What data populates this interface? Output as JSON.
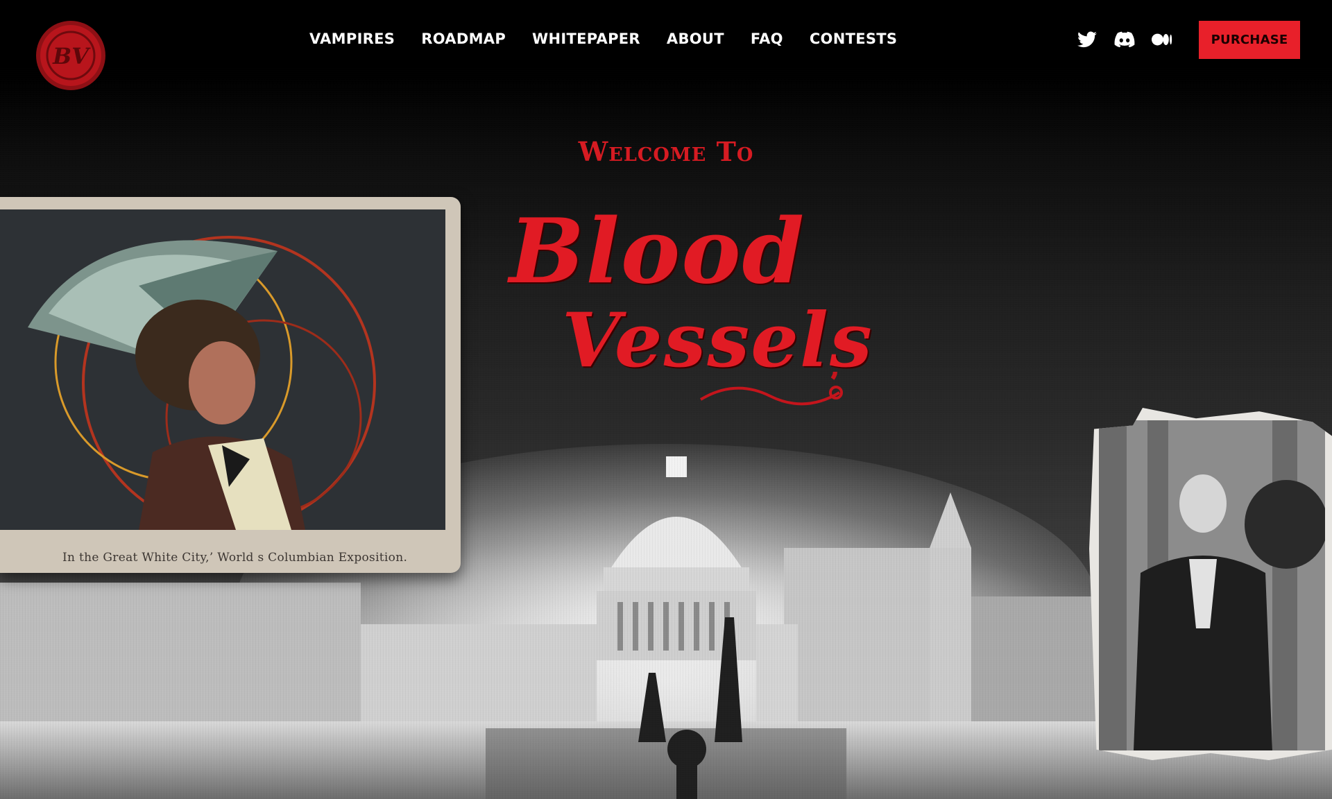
{
  "nav": {
    "logo_alt": "BV",
    "links": [
      "VAMPIRES",
      "ROADMAP",
      "WHITEPAPER",
      "ABOUT",
      "FAQ",
      "CONTESTS"
    ],
    "socials": [
      "twitter-icon",
      "discord-icon",
      "medium-icon"
    ],
    "purchase_label": "PURCHASE"
  },
  "hero": {
    "welcome": "Welcome To",
    "title_line1": "Blood",
    "title_line2": "Vessels"
  },
  "postcard": {
    "caption": "In the Great   White City,’ World s Columbian Exposition."
  },
  "colors": {
    "accent": "#e8202a",
    "title_red": "#e11b24",
    "background": "#050505"
  }
}
